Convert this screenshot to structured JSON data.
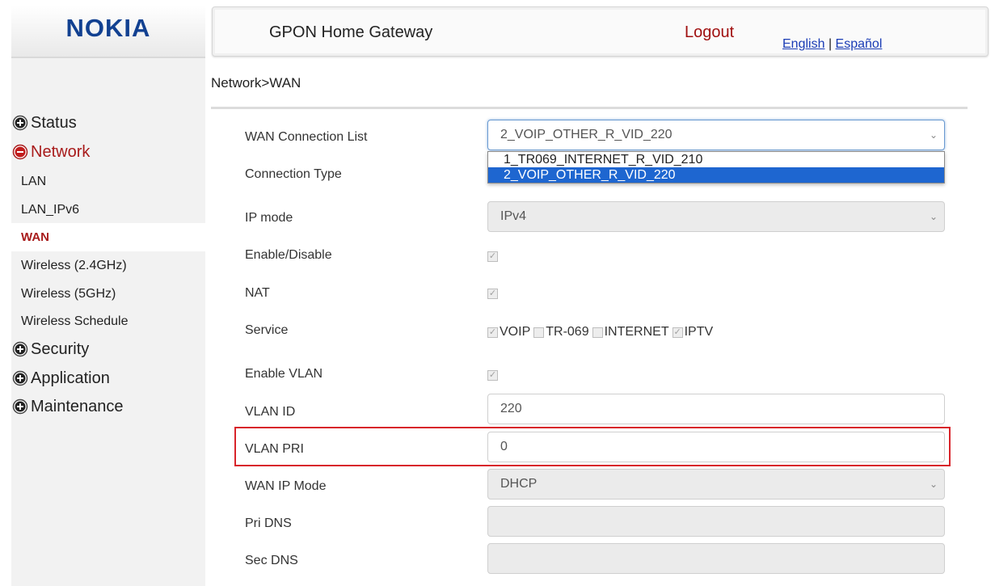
{
  "brand": {
    "logo": "NOKIA",
    "accent": "#a81b1b",
    "logo_color": "#124191"
  },
  "header": {
    "title": "GPON Home Gateway",
    "logout": "Logout",
    "lang_en": "English",
    "lang_sep": "|",
    "lang_es": "Español"
  },
  "breadcrumb": "Network>WAN",
  "sidebar": {
    "status": "Status",
    "network": "Network",
    "network_items": [
      "LAN",
      "LAN_IPv6",
      "WAN",
      "Wireless (2.4GHz)",
      "Wireless (5GHz)",
      "Wireless Schedule"
    ],
    "security": "Security",
    "application": "Application",
    "maintenance": "Maintenance"
  },
  "form": {
    "wan_connection_list": {
      "label": "WAN Connection List",
      "value": "2_VOIP_OTHER_R_VID_220",
      "options": [
        "1_TR069_INTERNET_R_VID_210",
        "2_VOIP_OTHER_R_VID_220"
      ]
    },
    "connection_type": {
      "label": "Connection Type"
    },
    "ip_mode": {
      "label": "IP mode",
      "value": "IPv4"
    },
    "enable_disable": {
      "label": "Enable/Disable",
      "checked": true
    },
    "nat": {
      "label": "NAT",
      "checked": true
    },
    "service": {
      "label": "Service",
      "options": [
        "VOIP",
        "TR-069",
        "INTERNET",
        "IPTV"
      ]
    },
    "enable_vlan": {
      "label": "Enable VLAN",
      "checked": true
    },
    "vlan_id": {
      "label": "VLAN ID",
      "value": "220"
    },
    "vlan_pri": {
      "label": "VLAN PRI",
      "value": "0"
    },
    "wan_ip_mode": {
      "label": "WAN IP Mode",
      "value": "DHCP"
    },
    "pri_dns": {
      "label": "Pri DNS",
      "value": ""
    },
    "sec_dns": {
      "label": "Sec DNS",
      "value": ""
    }
  },
  "icons": {
    "expand": "plus-circle-icon",
    "collapse": "minus-circle-icon",
    "dropdown": "chevron-down-icon",
    "check": "checkmark-icon"
  }
}
